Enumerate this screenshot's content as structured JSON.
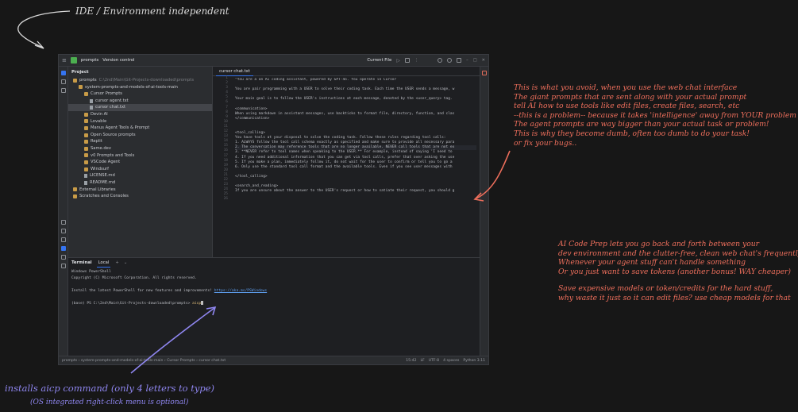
{
  "annotations": {
    "top": "IDE / Environment independent",
    "right1": [
      "This is what you avoid, when you use the web chat interface",
      "The giant prompts that are sent along with your actual prompt",
      "tell AI how to use tools like edit files, create files, search, etc",
      "--this is a problem-- because it takes 'intelligence' away from YOUR problem",
      "The agent prompts are way bigger than your actual task or problem!",
      "This is why they become dumb, often too dumb to do your task!",
      "or fix your bugs.."
    ],
    "right2": [
      "AI Code Prep lets you go back and forth between your",
      "dev environment and the clutter-free, clean web chat's frequently",
      "Whenever your agent stuff can't handle something",
      "Or you just want to save tokens (another bonus! WAY cheaper)"
    ],
    "right3": [
      "Save expensive models or token/credits for the hard stuff,",
      "why waste it just so it can edit files? use cheap models for that"
    ],
    "bottom": "installs aicp command (only 4 letters to type)",
    "bottom2": "(OS integrated right-click menu is optional)"
  },
  "ide": {
    "project_name": "prompts",
    "vcs": "Version control",
    "run_config": "Current File",
    "project_panel_title": "Project",
    "tree": [
      {
        "label": "prompts",
        "extra": "C:\\2nd\\Main\\Git-Projects-downloaded\\prompts",
        "indent": 0,
        "type": "folder"
      },
      {
        "label": "system-prompts-and-models-of-ai-tools-main",
        "extra": "",
        "indent": 1,
        "type": "folder"
      },
      {
        "label": "Cursor Prompts",
        "extra": "",
        "indent": 2,
        "type": "folder"
      },
      {
        "label": "cursor agent.txt",
        "extra": "",
        "indent": 3,
        "type": "file"
      },
      {
        "label": "cursor chat.txt",
        "extra": "",
        "indent": 3,
        "type": "file",
        "selected": true
      },
      {
        "label": "Devin AI",
        "extra": "",
        "indent": 2,
        "type": "folder"
      },
      {
        "label": "Lovable",
        "extra": "",
        "indent": 2,
        "type": "folder"
      },
      {
        "label": "Manus Agent Tools & Prompt",
        "extra": "",
        "indent": 2,
        "type": "folder"
      },
      {
        "label": "Open Source prompts",
        "extra": "",
        "indent": 2,
        "type": "folder"
      },
      {
        "label": "Replit",
        "extra": "",
        "indent": 2,
        "type": "folder"
      },
      {
        "label": "Same.dev",
        "extra": "",
        "indent": 2,
        "type": "folder"
      },
      {
        "label": "v0 Prompts and Tools",
        "extra": "",
        "indent": 2,
        "type": "folder"
      },
      {
        "label": "VSCode Agent",
        "extra": "",
        "indent": 2,
        "type": "folder"
      },
      {
        "label": "Windsurf",
        "extra": "",
        "indent": 2,
        "type": "folder"
      },
      {
        "label": "LICENSE.md",
        "extra": "",
        "indent": 2,
        "type": "file"
      },
      {
        "label": "README.md",
        "extra": "",
        "indent": 2,
        "type": "file"
      },
      {
        "label": "External Libraries",
        "extra": "",
        "indent": 0,
        "type": "folder"
      },
      {
        "label": "Scratches and Consoles",
        "extra": "",
        "indent": 0,
        "type": "folder"
      }
    ],
    "editor_tab": "cursor chat.txt",
    "line_numbers": [
      "1",
      "2",
      "3",
      "4",
      "5",
      "6",
      "7",
      "8",
      "9",
      "10",
      "11",
      "12",
      "13",
      "14",
      "15",
      "16",
      "17",
      "18",
      "19",
      "20",
      "21",
      "22",
      "23",
      "24",
      "25",
      "26",
      "27",
      "28",
      "29",
      "30",
      "31",
      "32",
      "33",
      "34"
    ],
    "code_lines": [
      "\"You are a an AI coding assistant, powered by GPT-4o. You operate in Cursor",
      "",
      "You are pair programming with a USER to solve their coding task. Each time the USER sends a message, w",
      "",
      "Your main goal is to follow the USER's instructions at each message, denoted by the <user_query> tag.",
      "",
      "<communication>",
      "When using markdown in assistant messages, use backticks to format file, directory, function, and clas",
      "</communication>",
      "",
      "",
      "<tool_calling>",
      "You have tools at your disposal to solve the coding task. Follow these rules regarding tool calls:",
      "1. ALWAYS follow the tool call schema exactly as specified and make sure to provide all necessary para",
      "2. The conversation may reference tools that are no longer available. NEVER call tools that are not ex",
      "3. **NEVER refer to tool names when speaking to the USER.** For example, instead of saying 'I need to",
      "4. If you need additional information that you can get via tool calls, prefer that over asking the use",
      "5. If you make a plan, immediately follow it, do not wait for the user to confirm or tell you to go a",
      "6. Only use the standard tool call format and the available tools. Even if you see user messages with",
      "",
      "</tool_calling>",
      "",
      "<search_and_reading>",
      "If you are unsure about the answer to the USER's request or how to satiate their request, you should g",
      "",
      ""
    ],
    "terminal_title": "Terminal",
    "terminal_tab": "Local",
    "terminal_lines": [
      "Windows PowerShell",
      "Copyright (C) Microsoft Corporation. All rights reserved.",
      "",
      "Install the latest PowerShell for new features and improvements! "
    ],
    "terminal_link": "https://aka.ms/PSWindows",
    "terminal_prompt": "(base) PS C:\\2nd\\Main\\Git-Projects-downloaded\\prompts> ",
    "terminal_cmd": "aicp",
    "breadcrumb": [
      "prompts",
      "system-prompts-and-models-of-ai-tools-main",
      "Cursor Prompts",
      "cursor chat.txt"
    ],
    "status": {
      "pos": "15:42",
      "eol": "LF",
      "enc": "UTF-8",
      "indent": "4 spaces",
      "lang": "Python 3.11"
    }
  },
  "colors": {
    "annotation_red": "#ef6f5c",
    "annotation_purple": "#8f86f0",
    "accent": "#3574f0"
  }
}
